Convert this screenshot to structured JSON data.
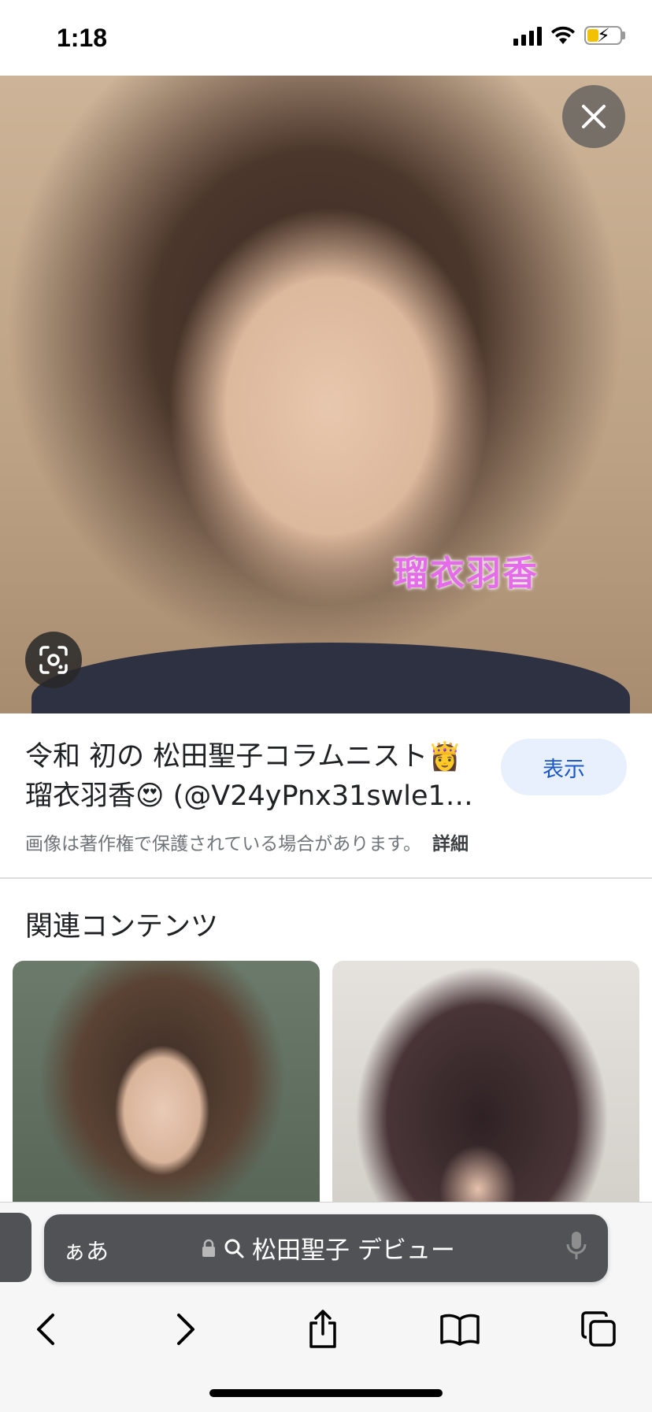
{
  "status_bar": {
    "time": "1:18",
    "icons": [
      "cellular-signal-icon",
      "wifi-icon",
      "battery-charging-icon"
    ]
  },
  "viewer": {
    "watermark": "瑠衣羽香",
    "close_icon": "close-icon",
    "lens_icon": "lens-icon"
  },
  "result": {
    "title_line1": "令和 初の 松田聖子コラムニスト👸",
    "title_line2": "瑠衣羽香😍 (@V24yPnx31swle1Q ...",
    "view_button": "表示",
    "copyright": "画像は著作権で保護されている場合があります。",
    "details_link": "詳細"
  },
  "related": {
    "heading": "関連コンテンツ"
  },
  "browser": {
    "aa_label": "ぁあ",
    "url_text": "松田聖子 デビュー",
    "toolbar": [
      "back-icon",
      "forward-icon",
      "share-icon",
      "bookmarks-icon",
      "tabs-icon"
    ]
  },
  "colors": {
    "accent_button_bg": "#e8f0fe",
    "accent_button_text": "#1a57c8",
    "url_bar_bg": "#505255",
    "watermark": "#e46ce8"
  }
}
